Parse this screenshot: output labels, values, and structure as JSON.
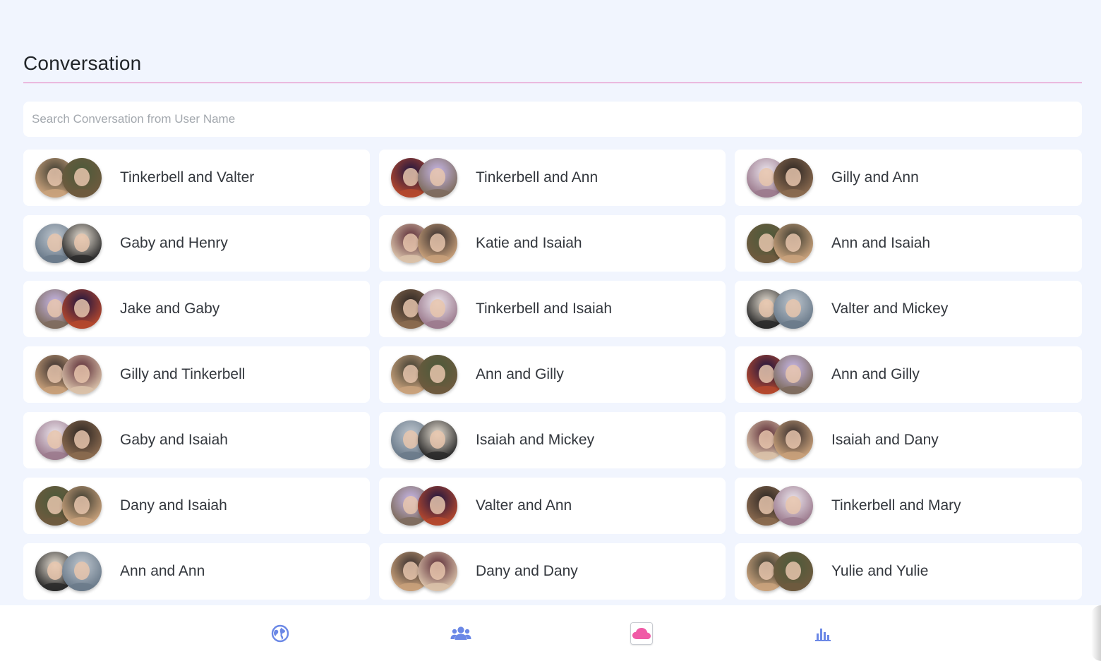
{
  "header": {
    "title": "Conversation"
  },
  "search": {
    "placeholder": "Search Conversation from User Name",
    "value": ""
  },
  "conversations": [
    {
      "label": "Tinkerbell and Valter"
    },
    {
      "label": "Tinkerbell and Ann"
    },
    {
      "label": "Gilly and Ann"
    },
    {
      "label": "Gaby and Henry"
    },
    {
      "label": "Katie and Isaiah"
    },
    {
      "label": "Ann and Isaiah"
    },
    {
      "label": "Jake and Gaby"
    },
    {
      "label": "Tinkerbell and Isaiah"
    },
    {
      "label": "Valter and Mickey"
    },
    {
      "label": "Gilly and Tinkerbell"
    },
    {
      "label": "Ann and Gilly"
    },
    {
      "label": "Ann and Gilly"
    },
    {
      "label": "Gaby and Isaiah"
    },
    {
      "label": "Isaiah and Mickey"
    },
    {
      "label": "Isaiah and Dany"
    },
    {
      "label": "Dany and Isaiah"
    },
    {
      "label": "Valter and Ann"
    },
    {
      "label": "Tinkerbell and Mary"
    },
    {
      "label": "Ann and Ann"
    },
    {
      "label": "Dany and Dany"
    },
    {
      "label": "Yulie and Yulie"
    }
  ],
  "bottom_nav": [
    {
      "icon": "globe-icon",
      "active": false
    },
    {
      "icon": "users-icon",
      "active": false
    },
    {
      "icon": "cloud-icon",
      "active": true
    },
    {
      "icon": "bar-chart-icon",
      "active": false
    }
  ],
  "colors": {
    "background": "#f1f5fe",
    "accent_rule": "#e36fb6",
    "nav_icon": "#6b88e6",
    "nav_active_icon": "#f05aa6"
  }
}
